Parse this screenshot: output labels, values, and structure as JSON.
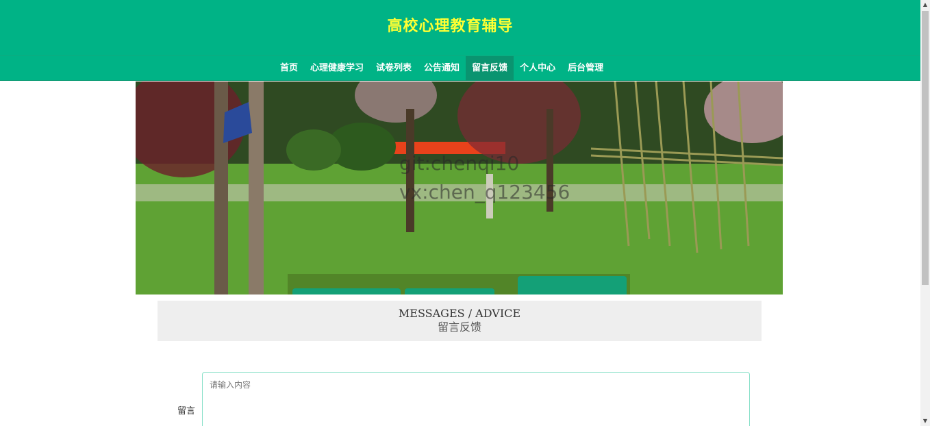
{
  "header": {
    "title": "高校心理教育辅导"
  },
  "nav": {
    "items": [
      "首页",
      "心理健康学习",
      "试卷列表",
      "公告通知",
      "留言反馈",
      "个人中心",
      "后台管理"
    ],
    "active": "留言反馈"
  },
  "banner": {
    "watermark_line1": "git:chenqi10",
    "watermark_line2": "vx:chen_q123456"
  },
  "section": {
    "title_en": "MESSAGES / ADVICE",
    "title_cn": "留言反馈"
  },
  "form": {
    "message_label": "留言",
    "message_placeholder": "请输入内容",
    "message_value": ""
  },
  "colors": {
    "primary": "#00b386",
    "title_yellow": "#ffff33",
    "nav_active": "#0a9470"
  }
}
